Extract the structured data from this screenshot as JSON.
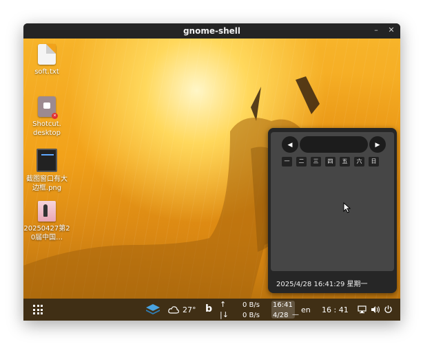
{
  "window": {
    "title": "gnome-shell",
    "minimize_label": "–",
    "close_label": "✕"
  },
  "desktop_icons": [
    {
      "label": "soft.txt",
      "icon": "text-file-icon"
    },
    {
      "label": "Shotcut.\ndesktop",
      "icon": "desktop-file-icon"
    },
    {
      "label": "截图窗口有大边框.png",
      "icon": "screenshot-image-icon"
    },
    {
      "label": "20250427第20届中国…",
      "icon": "photo-image-icon"
    }
  ],
  "calendar": {
    "prev_label": "◀",
    "next_label": "▶",
    "month_label": "",
    "weekdays": [
      "一",
      "二",
      "三",
      "四",
      "五",
      "六",
      "日"
    ],
    "datetime": "2025/4/28 16:41:29 星期一"
  },
  "taskbar": {
    "weather_temp": "27°",
    "bing_label": "b",
    "net_up_arrow": "↑",
    "net_down_arrow": "|↓",
    "net_up": "0 B/s",
    "net_down": "0 B/s",
    "mini_time": "16:41",
    "mini_date": "4/28",
    "separator": "—",
    "language": "en",
    "clock": "16 : 41"
  },
  "colors": {
    "accent_orange": "#f2a21a",
    "taskbar_bg": "#46321a",
    "popup_bg": "#262626",
    "popup_inner": "#464646"
  }
}
